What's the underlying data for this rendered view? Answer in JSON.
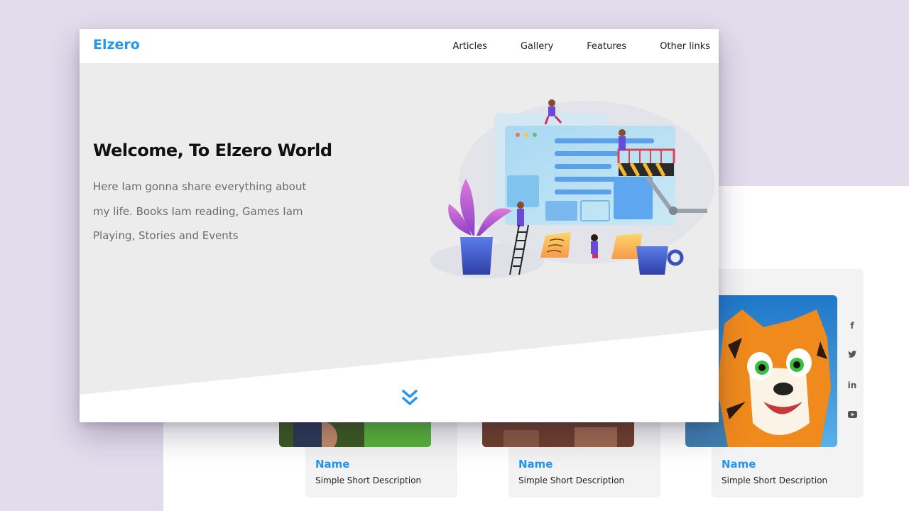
{
  "app": {
    "logo": "Elzero"
  },
  "nav": {
    "items": [
      "Articles",
      "Gallery",
      "Features",
      "Other links"
    ]
  },
  "hero": {
    "title": "Welcome, To Elzero World",
    "text": "Here Iam gonna share everything about my life. Books Iam reading, Games Iam Playing, Stories and Events"
  },
  "cards": [
    {
      "name": "Name",
      "description": "Simple Short Description",
      "image": "game-character-image"
    },
    {
      "name": "Name",
      "description": "Simple Short Description",
      "image": "battle-scene-image"
    },
    {
      "name": "Name",
      "description": "Simple Short Description",
      "image": "cartoon-tiger-image"
    }
  ],
  "socials": [
    "facebook-icon",
    "twitter-icon",
    "linkedin-icon",
    "youtube-icon"
  ],
  "colors": {
    "accent": "#2196f3",
    "background": "#e3dcec",
    "hero": "#ececec"
  },
  "icons": {
    "scroll": "double-chevron-down-icon"
  }
}
